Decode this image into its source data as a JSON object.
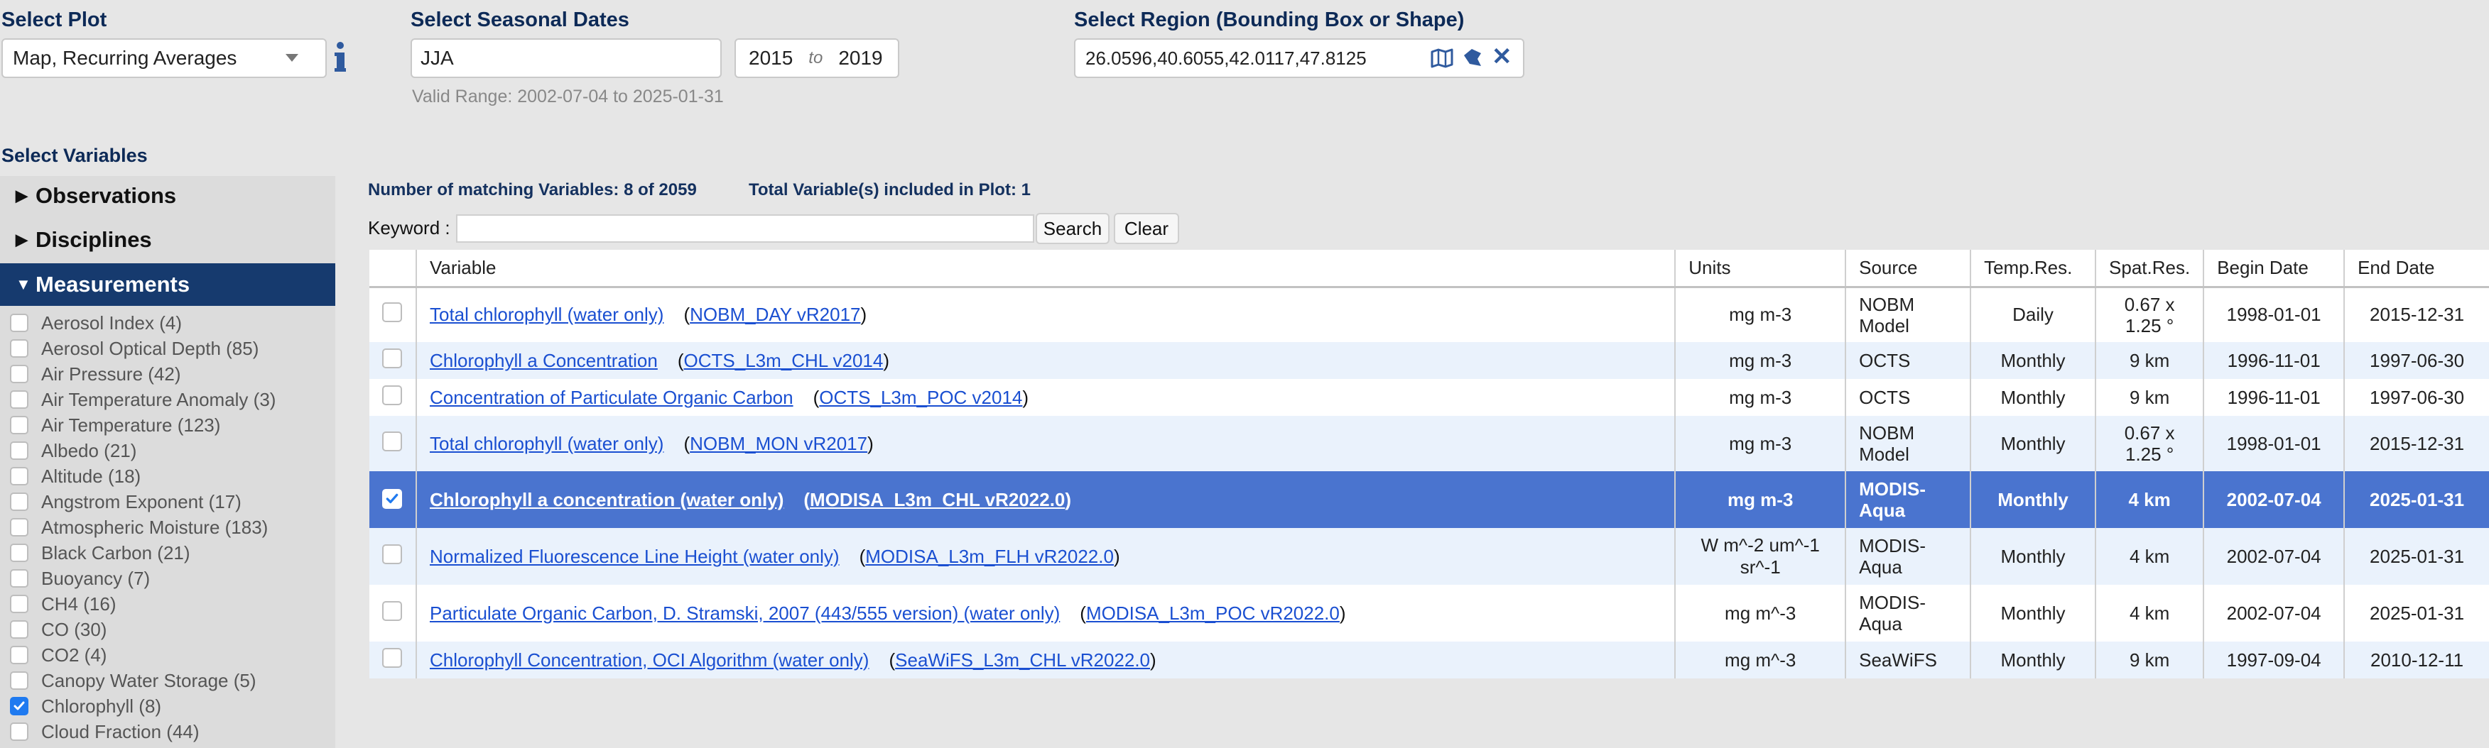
{
  "plot": {
    "title": "Select Plot",
    "selected": "Map, Recurring Averages",
    "info_icon": "info-icon"
  },
  "dates": {
    "title": "Select Seasonal Dates",
    "season": "JJA",
    "start_year": "2015",
    "to": "to",
    "end_year": "2019",
    "valid_range": "Valid Range: 2002-07-04 to 2025-01-31"
  },
  "region": {
    "title": "Select Region (Bounding Box or Shape)",
    "value": "26.0596,40.6055,42.0117,47.8125",
    "icons": [
      "map-icon",
      "shape-icon",
      "clear-x-icon"
    ]
  },
  "variables": {
    "title": "Select Variables",
    "accordions": {
      "observations": "Observations",
      "disciplines": "Disciplines",
      "measurements": "Measurements"
    },
    "measurements": [
      {
        "label": "Aerosol Index (4)",
        "checked": false
      },
      {
        "label": "Aerosol Optical Depth (85)",
        "checked": false
      },
      {
        "label": "Air Pressure (42)",
        "checked": false
      },
      {
        "label": "Air Temperature Anomaly (3)",
        "checked": false
      },
      {
        "label": "Air Temperature (123)",
        "checked": false
      },
      {
        "label": "Albedo (21)",
        "checked": false
      },
      {
        "label": "Altitude (18)",
        "checked": false
      },
      {
        "label": "Angstrom Exponent (17)",
        "checked": false
      },
      {
        "label": "Atmospheric Moisture (183)",
        "checked": false
      },
      {
        "label": "Black Carbon (21)",
        "checked": false
      },
      {
        "label": "Buoyancy (7)",
        "checked": false
      },
      {
        "label": "CH4 (16)",
        "checked": false
      },
      {
        "label": "CO (30)",
        "checked": false
      },
      {
        "label": "CO2 (4)",
        "checked": false
      },
      {
        "label": "Canopy Water Storage (5)",
        "checked": false
      },
      {
        "label": "Chlorophyll (8)",
        "checked": true
      },
      {
        "label": "Cloud Fraction (44)",
        "checked": false
      }
    ]
  },
  "results": {
    "matching": "Number of matching Variables: 8 of 2059",
    "included": "Total Variable(s) included in Plot: 1",
    "keyword_label": "Keyword :",
    "search_btn": "Search",
    "clear_btn": "Clear",
    "headers": [
      "Variable",
      "Units",
      "Source",
      "Temp.Res.",
      "Spat.Res.",
      "Begin Date",
      "End Date"
    ],
    "rows": [
      {
        "name": "Total chlorophyll (water only)",
        "product": "NOBM_DAY vR2017",
        "units": "mg m-3",
        "source": "NOBM Model",
        "temp": "Daily",
        "spat": "0.67 x 1.25 °",
        "begin": "1998-01-01",
        "end": "2015-12-31",
        "checked": false
      },
      {
        "name": "Chlorophyll a Concentration",
        "product": "OCTS_L3m_CHL v2014",
        "units": "mg m-3",
        "source": "OCTS",
        "temp": "Monthly",
        "spat": "9 km",
        "begin": "1996-11-01",
        "end": "1997-06-30",
        "checked": false
      },
      {
        "name": "Concentration of Particulate Organic Carbon",
        "product": "OCTS_L3m_POC v2014",
        "units": "mg m-3",
        "source": "OCTS",
        "temp": "Monthly",
        "spat": "9 km",
        "begin": "1996-11-01",
        "end": "1997-06-30",
        "checked": false
      },
      {
        "name": "Total chlorophyll (water only)",
        "product": "NOBM_MON vR2017",
        "units": "mg m-3",
        "source": "NOBM Model",
        "temp": "Monthly",
        "spat": "0.67 x 1.25 °",
        "begin": "1998-01-01",
        "end": "2015-12-31",
        "checked": false
      },
      {
        "name": "Chlorophyll a concentration (water only)",
        "product": "MODISA_L3m_CHL vR2022.0",
        "units": "mg m-3",
        "source": "MODIS-Aqua",
        "temp": "Monthly",
        "spat": "4 km",
        "begin": "2002-07-04",
        "end": "2025-01-31",
        "checked": true
      },
      {
        "name": "Normalized Fluorescence Line Height (water only)",
        "product": "MODISA_L3m_FLH vR2022.0",
        "units": "W m^-2 um^-1 sr^-1",
        "source": "MODIS-Aqua",
        "temp": "Monthly",
        "spat": "4 km",
        "begin": "2002-07-04",
        "end": "2025-01-31",
        "checked": false
      },
      {
        "name": "Particulate Organic Carbon, D. Stramski, 2007 (443/555 version) (water only)",
        "product": "MODISA_L3m_POC vR2022.0",
        "units": "mg m^-3",
        "source": "MODIS-Aqua",
        "temp": "Monthly",
        "spat": "4 km",
        "begin": "2002-07-04",
        "end": "2025-01-31",
        "checked": false
      },
      {
        "name": "Chlorophyll Concentration, OCI Algorithm (water only)",
        "product": "SeaWiFS_L3m_CHL vR2022.0",
        "units": "mg m^-3",
        "source": "SeaWiFS",
        "temp": "Monthly",
        "spat": "9 km",
        "begin": "1997-09-04",
        "end": "2010-12-11",
        "checked": false
      }
    ]
  }
}
